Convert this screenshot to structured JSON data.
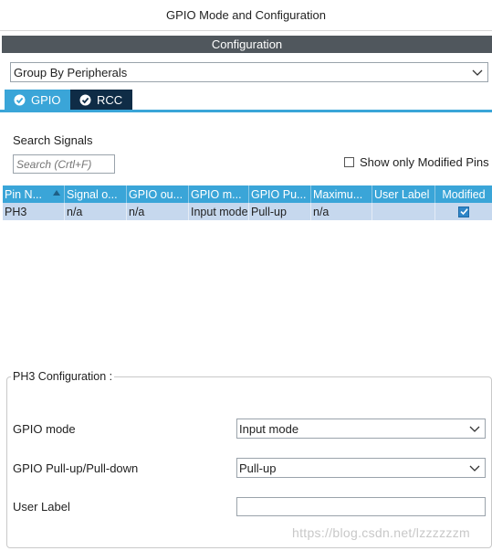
{
  "window": {
    "title": "GPIO Mode and Configuration"
  },
  "config_header": "Configuration",
  "group_by": {
    "value": "Group By Peripherals"
  },
  "tabs": [
    {
      "label": "GPIO",
      "active": true
    },
    {
      "label": "RCC",
      "active": false
    }
  ],
  "search": {
    "label": "Search Signals",
    "placeholder": "Search (Crtl+F)"
  },
  "show_modified": {
    "label": "Show only Modified Pins",
    "checked": false
  },
  "table": {
    "headers": [
      "Pin N...",
      "Signal o...",
      "GPIO ou...",
      "GPIO m...",
      "GPIO Pu...",
      "Maximu...",
      "User Label",
      "Modified"
    ],
    "rows": [
      {
        "pin": "PH3",
        "signal": "n/a",
        "gpio_output": "n/a",
        "gpio_mode": "Input mode",
        "gpio_pull": "Pull-up",
        "maximum": "n/a",
        "user_label": "",
        "modified": true
      }
    ]
  },
  "pin_config": {
    "title": "PH3 Configuration :",
    "gpio_mode": {
      "label": "GPIO mode",
      "value": "Input mode"
    },
    "gpio_pull": {
      "label": "GPIO Pull-up/Pull-down",
      "value": "Pull-up"
    },
    "user_label": {
      "label": "User Label",
      "value": ""
    }
  },
  "watermark": "https://blog.csdn.net/lzzzzzzm",
  "colors": {
    "accent": "#3aa5d8",
    "tab_dark": "#0f2c46",
    "header_bar": "#50575d",
    "row_selected": "#c6d8ee"
  }
}
